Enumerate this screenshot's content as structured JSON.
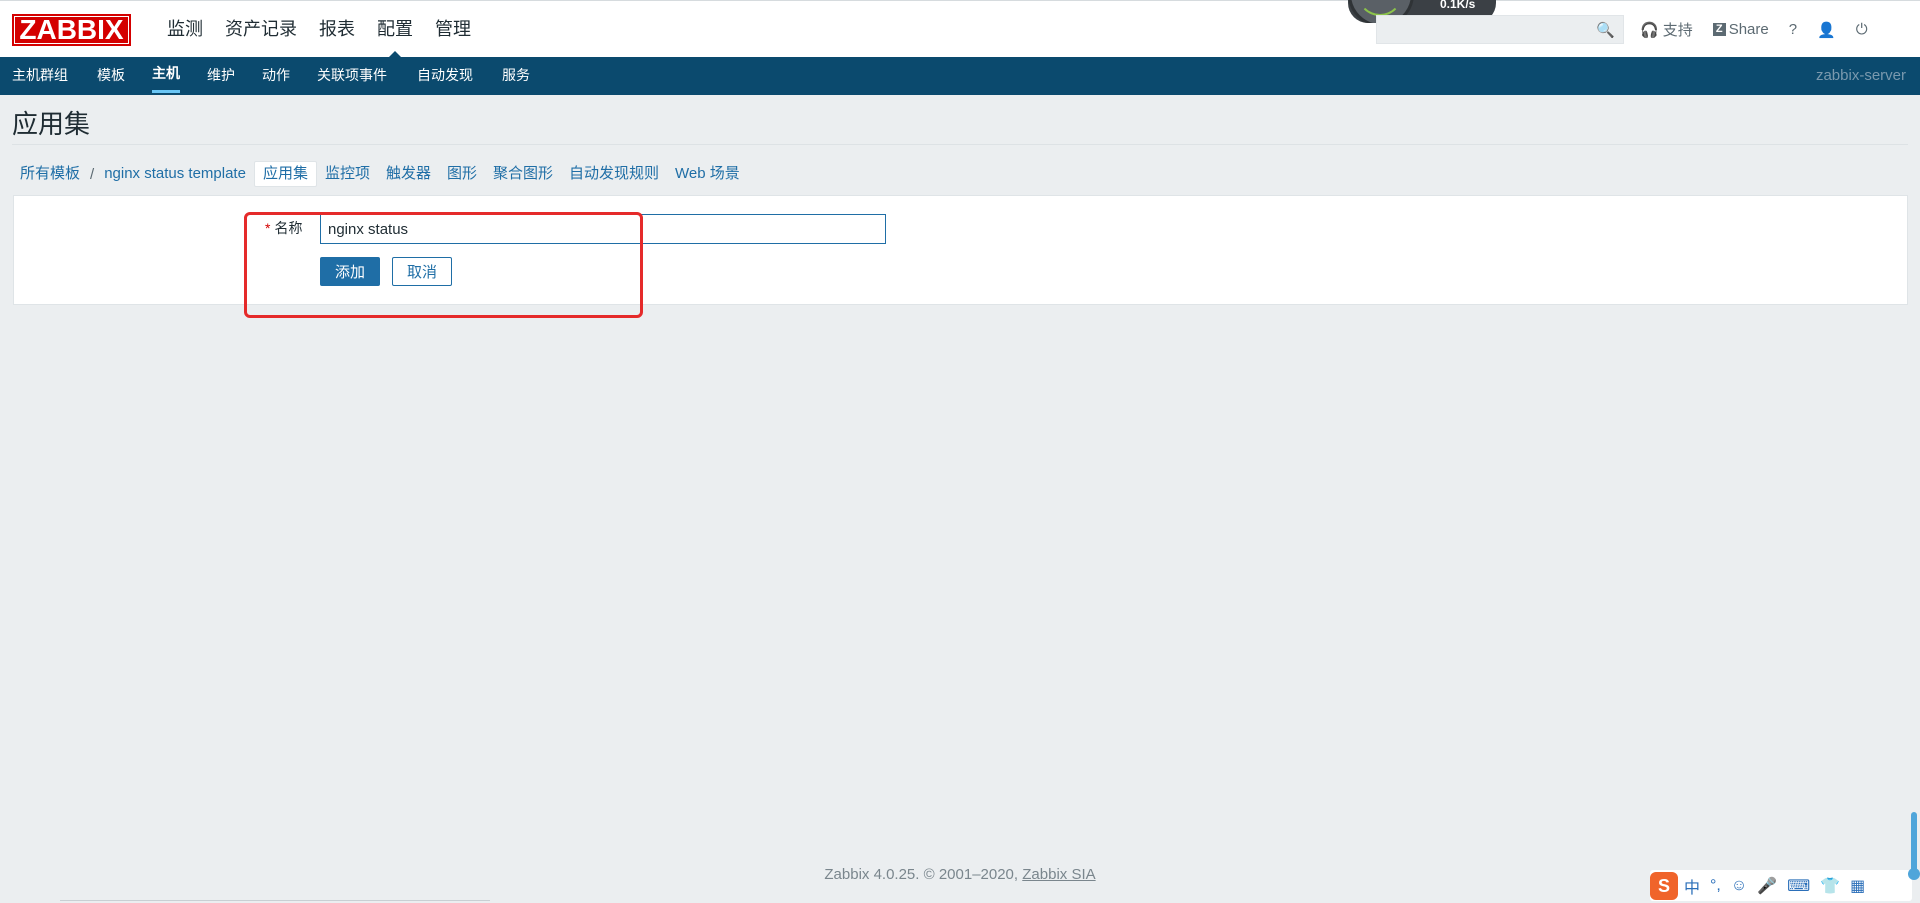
{
  "logo": "ZABBIX",
  "main_nav": [
    "监测",
    "资产记录",
    "报表",
    "配置",
    "管理"
  ],
  "main_nav_active": "配置",
  "widget_speed": "0.1K/s",
  "top_links": {
    "support": "支持",
    "share": "Share",
    "help": "?"
  },
  "sub_nav": [
    "主机群组",
    "模板",
    "主机",
    "维护",
    "动作",
    "关联项事件",
    "自动发现",
    "服务"
  ],
  "sub_nav_active": "主机",
  "server_name": "zabbix-server",
  "page_title": "应用集",
  "breadcrumbs": {
    "all_templates": "所有模板",
    "separator": "/",
    "template": "nginx status template",
    "tabs": [
      "应用集",
      "监控项",
      "触发器",
      "图形",
      "聚合图形",
      "自动发现规则",
      "Web 场景"
    ]
  },
  "form": {
    "required_mark": "*",
    "name_label": "名称",
    "name_value": "nginx status",
    "add_button": "添加",
    "cancel_button": "取消"
  },
  "footer": {
    "text": "Zabbix 4.0.25. © 2001–2020,",
    "link": "Zabbix SIA"
  },
  "ime": {
    "logo": "S",
    "items": [
      "中",
      "°,",
      "☺",
      "🎤",
      "⌨",
      "👕",
      "▦"
    ]
  },
  "colors": {
    "brand_red": "#d40000",
    "subnav_bg": "#0b4a6e",
    "link_blue": "#1f6ea6",
    "highlight_red": "#e52a2a"
  }
}
